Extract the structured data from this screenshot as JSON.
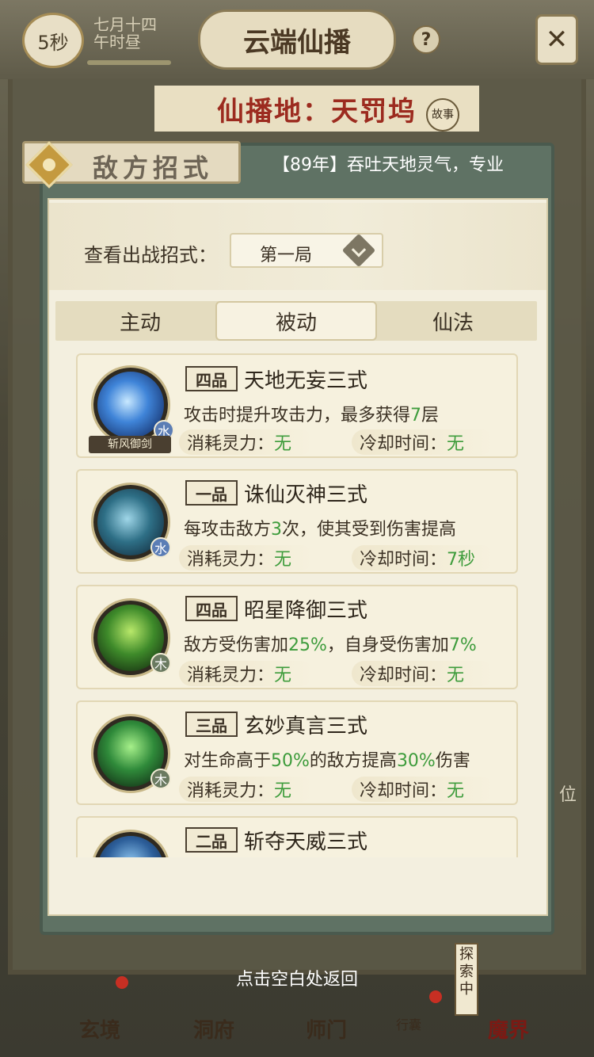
{
  "top_bar": {
    "timer": "5秒",
    "date_line1": "七月十四",
    "date_line2": "午时昼",
    "title": "云端仙播",
    "help_label": "?",
    "close_label": "✕"
  },
  "location": {
    "title": "仙播地：天罚坞",
    "story_tag": "故事"
  },
  "side_char": "位",
  "dialog": {
    "header_title": "敌方招式",
    "marquee": "【89年】吞吐天地灵气，专业",
    "filter_label": "查看出战招式：",
    "round_select": "第一局",
    "tabs": [
      "主动",
      "被动",
      "仙法"
    ],
    "active_tab_index": 1,
    "stat_labels": {
      "mana": "消耗灵力：",
      "cooldown": "冷却时间："
    },
    "skills": [
      {
        "grade": "四品",
        "name": "天地无妄三式",
        "desc_parts": [
          "攻击时提升攻击力，最多获得",
          "7",
          "层"
        ],
        "mana": "无",
        "cooldown": "无",
        "element": "水",
        "caption": "斩风御剑",
        "icon": "ice-blade-icon"
      },
      {
        "grade": "一品",
        "name": "诛仙灭神三式",
        "desc_parts": [
          "每攻击敌方",
          "3",
          "次，使其受到伤害提高"
        ],
        "mana": "无",
        "cooldown": "7秒",
        "element": "水",
        "icon": "sword-slash-icon"
      },
      {
        "grade": "四品",
        "name": "昭星降御三式",
        "desc_parts": [
          "敌方受伤害加",
          "25%",
          "，自身受伤害加",
          "7%"
        ],
        "mana": "无",
        "cooldown": "无",
        "element": "木",
        "icon": "green-aura-icon"
      },
      {
        "grade": "三品",
        "name": "玄妙真言三式",
        "desc_parts": [
          "对生命高于",
          "50%",
          "的敌方提高",
          "30%",
          "伤害"
        ],
        "mana": "无",
        "cooldown": "无",
        "element": "木",
        "icon": "green-sage-icon"
      },
      {
        "grade": "二品",
        "name": "斩夺天威三式",
        "icon": "blue-warrior-icon"
      }
    ]
  },
  "return_hint": "点击空白处返回",
  "bottom_nav": {
    "items": [
      "玄境",
      "洞府",
      "师门",
      "魔界"
    ],
    "bag": "行囊",
    "explore": "探索中"
  },
  "colors": {
    "accent_green": "#3e9c3c",
    "dialog_frame": "#5f7264",
    "card_bg": "#f6f1de"
  }
}
